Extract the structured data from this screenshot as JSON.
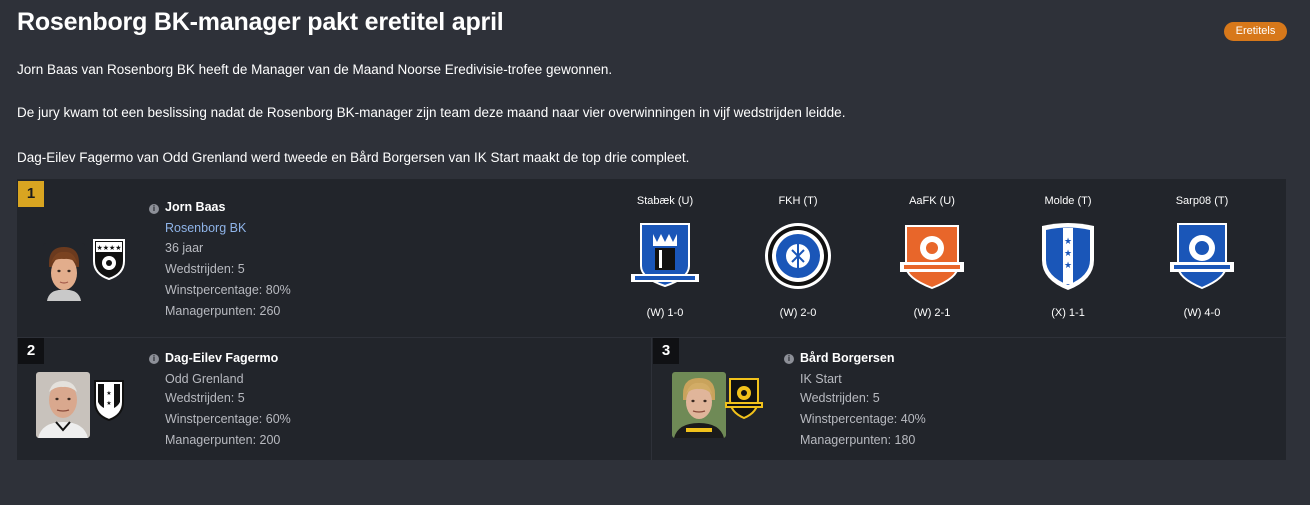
{
  "header": {
    "title": "Rosenborg BK-manager pakt eretitel april",
    "tag": "Eretitels"
  },
  "body": {
    "p1": "Jorn Baas van Rosenborg BK heeft de Manager van de Maand Noorse Eredivisie-trofee gewonnen.",
    "p2": "De jury kwam tot een beslissing nadat de Rosenborg BK-manager zijn team deze maand naar vier overwinningen in vijf wedstrijden leidde.",
    "p3": "Dag-Eilev Fagermo van Odd Grenland werd tweede en Bård Borgersen van IK Start maakt de top drie compleet."
  },
  "winner": {
    "rank": "1",
    "name": "Jorn Baas",
    "club": "Rosenborg BK",
    "age": "36 jaar",
    "matches": "Wedstrijden: 5",
    "winpct": "Winstpercentage: 80%",
    "points": "Managerpunten: 260",
    "matches_list": [
      {
        "opponent": "Stabæk (U)",
        "result": "(W) 1-0"
      },
      {
        "opponent": "FKH (T)",
        "result": "(W) 2-0"
      },
      {
        "opponent": "AaFK (U)",
        "result": "(W) 2-1"
      },
      {
        "opponent": "Molde (T)",
        "result": "(X) 1-1"
      },
      {
        "opponent": "Sarp08 (T)",
        "result": "(W) 4-0"
      }
    ]
  },
  "second": {
    "rank": "2",
    "name": "Dag-Eilev Fagermo",
    "club": "Odd Grenland",
    "matches": "Wedstrijden: 5",
    "winpct": "Winstpercentage: 60%",
    "points": "Managerpunten: 200"
  },
  "third": {
    "rank": "3",
    "name": "Bård Borgersen",
    "club": "IK Start",
    "matches": "Wedstrijden: 5",
    "winpct": "Winstpercentage: 40%",
    "points": "Managerpunten: 180"
  },
  "icons": {
    "info": "info-icon",
    "accent": "#d7781a",
    "gold": "#d9a521"
  }
}
